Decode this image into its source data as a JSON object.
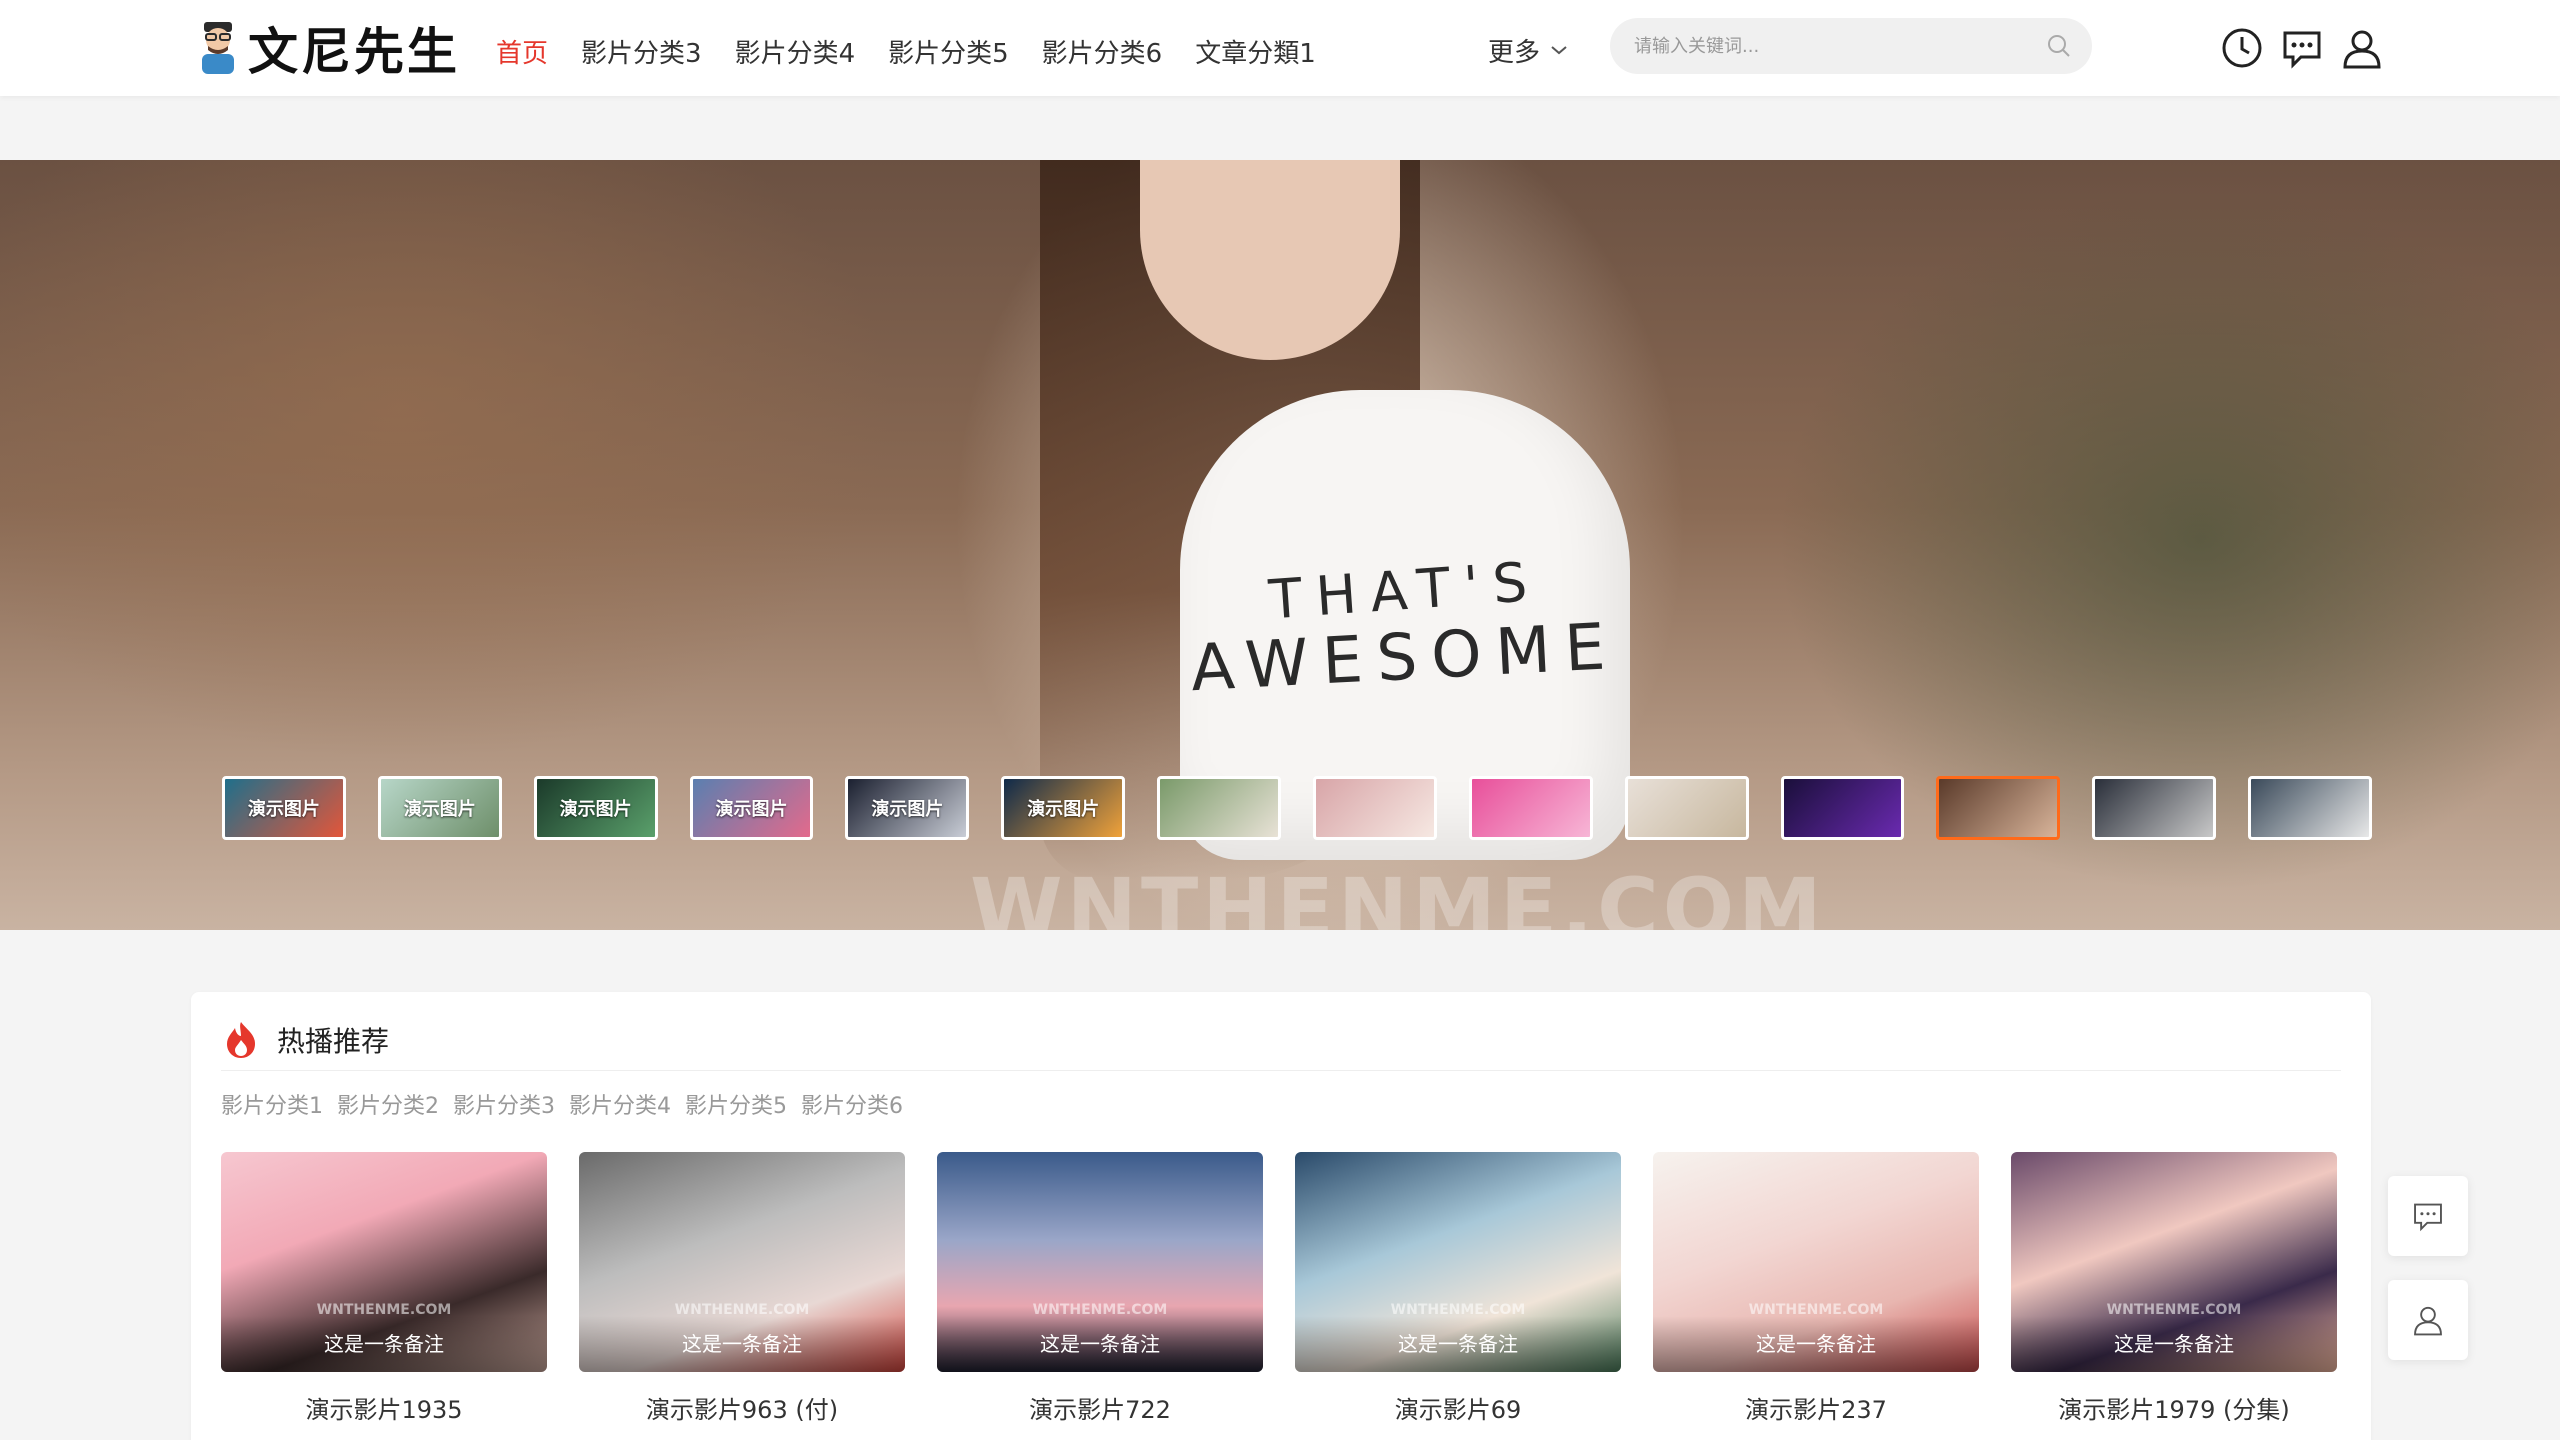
{
  "header": {
    "logo_text": "文尼先生",
    "nav": [
      "首页",
      "影片分类3",
      "影片分类4",
      "影片分类5",
      "影片分类6",
      "文章分類1"
    ],
    "more_label": "更多",
    "search_placeholder": "请输入关键词..."
  },
  "hero": {
    "shirt_line1": "THAT'S",
    "shirt_line2": "AWESOME",
    "watermark": "WNTHENME.COM",
    "thumbs": [
      {
        "label": "演示图片",
        "bg": "linear-gradient(135deg,#1f6f8b,#e3563a)"
      },
      {
        "label": "演示图片",
        "bg": "linear-gradient(135deg,#b7d6c8,#6e8f6a)"
      },
      {
        "label": "演示图片",
        "bg": "linear-gradient(135deg,#1b3a2a,#5aa06b)"
      },
      {
        "label": "演示图片",
        "bg": "linear-gradient(135deg,#5a7fb0,#e36a8c)"
      },
      {
        "label": "演示图片",
        "bg": "linear-gradient(135deg,#1b2030,#c9cdd6)"
      },
      {
        "label": "演示图片",
        "bg": "linear-gradient(135deg,#0f2a4a,#f0a23a)"
      },
      {
        "label": "",
        "bg": "linear-gradient(135deg,#7a9a6a,#e8e2d6)"
      },
      {
        "label": "",
        "bg": "linear-gradient(135deg,#d8a5a8,#f6e8e2)"
      },
      {
        "label": "",
        "bg": "linear-gradient(135deg,#e84f9a,#f7b6d6)"
      },
      {
        "label": "",
        "bg": "linear-gradient(135deg,#e8e0d8,#c7b79e)"
      },
      {
        "label": "",
        "bg": "linear-gradient(135deg,#1a0f3a,#6a2ab0)"
      },
      {
        "label": "",
        "bg": "linear-gradient(135deg,#5a3a2a,#d8b49a)"
      },
      {
        "label": "",
        "bg": "linear-gradient(135deg,#2a2f3a,#c8c8c8)"
      },
      {
        "label": "",
        "bg": "linear-gradient(135deg,#3a4a5a,#e8e8e8)"
      }
    ],
    "active_thumb": 11
  },
  "section": {
    "title": "热播推荐",
    "categories": [
      "影片分类1",
      "影片分类2",
      "影片分类3",
      "影片分类4",
      "影片分类5",
      "影片分类6"
    ]
  },
  "posters": [
    {
      "title": "演示影片1935",
      "note": "这是一条备注",
      "wm": "WNTHENME.COM",
      "bg": "linear-gradient(160deg,#f6c7d0 0%,#f2a9b6 35%,#3a2a2a 70%,#c7a59a 100%)"
    },
    {
      "title": "演示影片963 (付)",
      "note": "这是一条备注",
      "wm": "WNTHENME.COM",
      "bg": "linear-gradient(160deg,#6a6a6a 0%,#bdbdbd 40%,#e8d8d4 70%,#d0443c 100%)"
    },
    {
      "title": "演示影片722",
      "note": "这是一条备注",
      "wm": "WNTHENME.COM",
      "bg": "linear-gradient(180deg,#3a5a8a 0%,#9aa6c8 40%,#e8a6b0 70%,#1f2030 100%)"
    },
    {
      "title": "演示影片69",
      "note": "这是一条备注",
      "wm": "WNTHENME.COM",
      "bg": "linear-gradient(160deg,#2a4a6a 0%,#a8c8d8 40%,#f0e4d8 70%,#4a7a5a 100%)"
    },
    {
      "title": "演示影片237",
      "note": "这是一条备注",
      "wm": "WNTHENME.COM",
      "bg": "linear-gradient(160deg,#f6f2ee 0%,#f2d6d2 40%,#e8b6b0 70%,#c64a4a 100%)"
    },
    {
      "title": "演示影片1979 (分集)",
      "note": "这是一条备注",
      "wm": "WNTHENME.COM",
      "bg": "linear-gradient(160deg,#6a4a6a 0%,#f0c8c0 40%,#3a2a4a 70%,#f2b8a0 100%)"
    }
  ],
  "colors": {
    "accent": "#e5372c",
    "active_thumb_border": "#ff6a1a"
  }
}
